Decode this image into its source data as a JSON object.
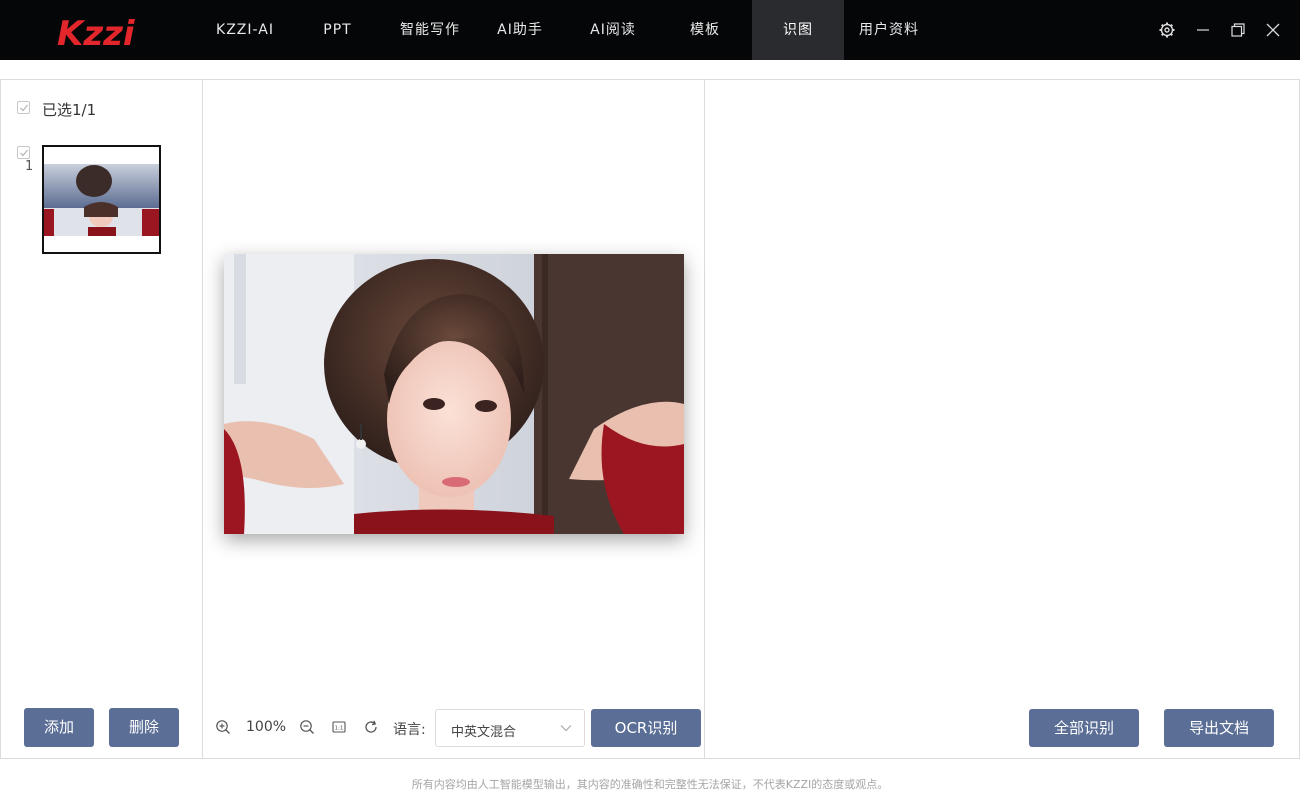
{
  "app": {
    "logo_text": "Kzzi",
    "brand_color": "#e3262b",
    "accent_color": "#5b6e96"
  },
  "nav": {
    "items": [
      {
        "label": "KZZI-AI"
      },
      {
        "label": "PPT"
      },
      {
        "label": "智能写作"
      },
      {
        "label": "AI助手"
      },
      {
        "label": "AI阅读"
      },
      {
        "label": "模板"
      },
      {
        "label": "识图",
        "active": true
      },
      {
        "label": "用户资料"
      }
    ],
    "window_controls": [
      "settings-icon",
      "minimize-icon",
      "restore-icon",
      "close-icon"
    ]
  },
  "left_panel": {
    "selected_label": "已选1/1",
    "thumbnails": [
      {
        "index": "1",
        "checked": true
      }
    ],
    "add_label": "添加",
    "delete_label": "删除"
  },
  "middle_panel": {
    "zoom": "100%",
    "language_label": "语言:",
    "language_value": "中英文混合",
    "ocr_label": "OCR识别",
    "tools": [
      "zoom-in-icon",
      "zoom-out-icon",
      "fit-icon",
      "rotate-icon"
    ]
  },
  "right_panel": {
    "recognize_all_label": "全部识别",
    "export_label": "导出文档"
  },
  "footer": {
    "disclaimer": "所有内容均由人工智能模型输出，其内容的准确性和完整性无法保证，不代表KZZI的态度或观点。"
  }
}
